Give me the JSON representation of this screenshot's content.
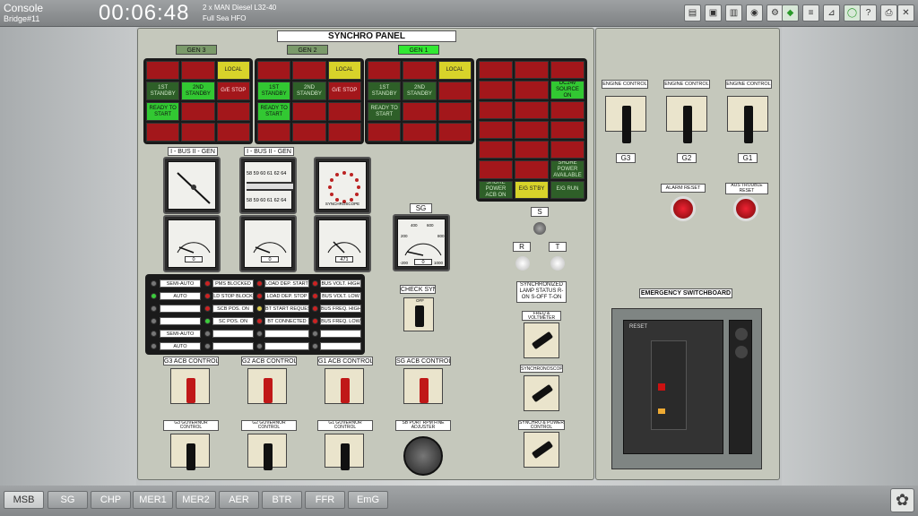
{
  "topbar": {
    "console": "Console",
    "bridge": "Bridge#11",
    "time": "00:06:48",
    "engine_line1": "2 x MAN Diesel L32-40",
    "engine_line2": "Full Sea HFO"
  },
  "synchro_panel": {
    "title": "SYNCHRO PANEL",
    "gen_tags": [
      "GEN 3",
      "GEN 2",
      "GEN 1"
    ],
    "gen_grids": [
      {
        "cells": [
          [
            "",
            "",
            " LOCAL"
          ],
          [
            "1ST STANDBY",
            "2ND STANDBY",
            "G/E STOP"
          ],
          [
            "READY TO START",
            "",
            ""
          ],
          [
            "",
            "",
            ""
          ]
        ]
      },
      {
        "cells": [
          [
            "",
            "",
            "LOCAL"
          ],
          [
            "1ST STANDBY",
            "2ND STANDBY",
            "G/E STOP"
          ],
          [
            "READY TO START",
            "",
            ""
          ],
          [
            "",
            "",
            ""
          ]
        ]
      },
      {
        "cells": [
          [
            "",
            "",
            "LOCAL"
          ],
          [
            "1ST STANDBY",
            "2ND STANDBY",
            ""
          ],
          [
            "READY TO START",
            "",
            ""
          ],
          [
            "",
            "",
            ""
          ]
        ]
      }
    ],
    "common_grid": [
      [
        "",
        "",
        ""
      ],
      [
        "",
        "",
        "DC24v SOURCE ON"
      ],
      [
        "",
        "",
        ""
      ],
      [
        "",
        "",
        ""
      ],
      [
        "",
        "",
        ""
      ],
      [
        "",
        "",
        "SHORE POWER AVAILABLE"
      ],
      [
        "SHORE POWER ACB ON",
        "E/G ST'BY",
        "E/G RUN"
      ]
    ],
    "meter_labels": [
      "I - BUS II - GEN",
      "I - BUS II - GEN"
    ],
    "synchroscope_label": "SYNCHROSCOPE",
    "freq_scale": "58 59 60 61 62 64",
    "freq_scale_bottom": "58 59 60 61 62 64",
    "kw_values": [
      "0",
      "0",
      "471"
    ],
    "sg_label": "SG",
    "sg_kw": "0",
    "sg_scale": [
      "400",
      "600",
      "200",
      "800",
      "-200",
      "1000"
    ],
    "s_label": "S",
    "r_label": "R",
    "t_label": "T",
    "check_sync": "CHECK SYNC",
    "sync_lamp_status": "SYNCHRONIZED LAMP STATUS R-ON S-OFF T-ON",
    "freq_voltmeter": "FREQ & VOLTMETER",
    "synchroscope_sw": "SYNCHRONOSCOPE",
    "synchro_power": "SYNCHRO & POWER CONTROL",
    "status": {
      "col1": [
        "SEMI-AUTO",
        "AUTO",
        "",
        ""
      ],
      "col2": [
        "PMS BLOCKED",
        "LD STOP BLOCK",
        "SCB POS. ON",
        "SC POS. ON"
      ],
      "col3": [
        "LOAD DEP. START",
        "LOAD DEP. STOP",
        "BT START REQUEST",
        "BT CONNECTED"
      ],
      "col4": [
        "BUS VOLT. HIGH",
        "BUS VOLT. LOW",
        "BUS FREQ. HIGH",
        "BUS FREQ. LOW"
      ],
      "row5": [
        "SEMI-AUTO",
        "",
        "",
        ""
      ],
      "row6": [
        "AUTO",
        "",
        "",
        ""
      ]
    },
    "acb": [
      "G3 ACB CONTROL",
      "G2 ACB CONTROL",
      "G1 ACB CONTROL",
      "SG ACB CONTROL"
    ],
    "gov": [
      "G3 GOVERNOR CONTROL",
      "G2 GOVERNOR CONTROL",
      "G1 GOVERNOR CONTROL",
      "SB PORT RPM FINE ADJUSTER"
    ],
    "off": "OFF"
  },
  "right_panel": {
    "engine_control": [
      "ENGINE CONTROL",
      "ENGINE CONTROL",
      "ENGINE CONTROL"
    ],
    "gen_labels": [
      "G3",
      "G2",
      "G1"
    ],
    "alarm_reset": "ALARM RESET",
    "aus_trouble_reset": "AUS TROUBLE RESET",
    "emergency": "EMERGENCY SWITCHBOARD",
    "reset": "RESET"
  },
  "tabs": [
    "MSB",
    "SG",
    "CHP",
    "MER1",
    "MER2",
    "AER",
    "BTR",
    "FFR",
    "EmG"
  ],
  "active_tab": "MSB",
  "colors": {
    "accent_green": "#32c832",
    "alarm_red": "#a3171b",
    "panel": "#c5c8bc"
  }
}
